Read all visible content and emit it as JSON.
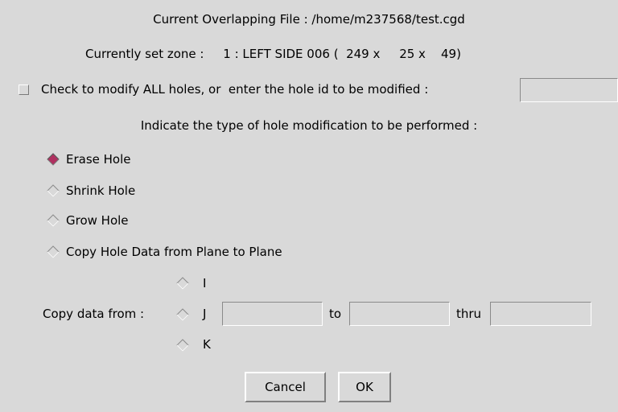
{
  "header": {
    "file_label": "Current Overlapping File : /home/m237568/test.cgd",
    "zone_label": "Currently set zone :     1 : LEFT SIDE 006 (  249 x     25 x    49)"
  },
  "hole_select": {
    "checkbox_label": "Check to modify ALL holes, or  enter the hole id to be modified :",
    "checked": false,
    "hole_id_value": ""
  },
  "modification": {
    "prompt": "Indicate the type of hole modification to be performed :",
    "selected": "Erase Hole",
    "options": [
      {
        "label": "Erase Hole"
      },
      {
        "label": "Shrink Hole"
      },
      {
        "label": "Grow Hole"
      },
      {
        "label": "Copy Hole Data from Plane to Plane"
      }
    ]
  },
  "copy": {
    "label": "Copy data from :",
    "planes": [
      {
        "label": "I"
      },
      {
        "label": "J"
      },
      {
        "label": "K"
      }
    ],
    "from_value": "",
    "to_label": "to",
    "to_value": "",
    "thru_label": "thru",
    "thru_value": ""
  },
  "buttons": {
    "cancel_label": "Cancel",
    "ok_label": "OK"
  },
  "colors": {
    "background": "#d9d9d9",
    "radio_selected": "#b03060",
    "radio_unselected": "#d9d9d9"
  }
}
